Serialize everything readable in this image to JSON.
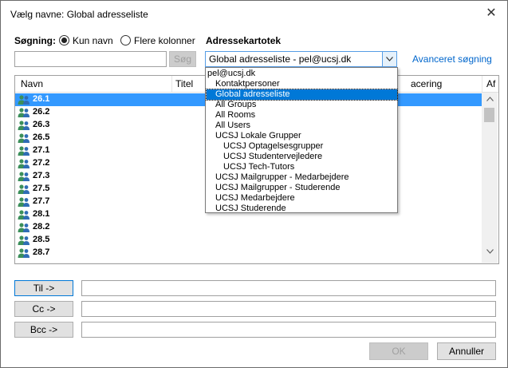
{
  "window": {
    "title": "Vælg navne: Global adresseliste",
    "close_glyph": "✕"
  },
  "search": {
    "label": "Søgning:",
    "option_name_only": "Kun navn",
    "option_more_columns": "Flere kolonner",
    "selected_option": "Kun navn",
    "input_value": "",
    "search_button": "Søg"
  },
  "address_book": {
    "label": "Adressekartotek",
    "selected": "Global adresseliste - pel@ucsj.dk",
    "advanced_link": "Avanceret søgning"
  },
  "dropdown": {
    "items": [
      {
        "label": "pel@ucsj.dk",
        "level": 0
      },
      {
        "label": "Kontaktpersoner",
        "level": 1
      },
      {
        "label": "Global adresseliste",
        "level": 1,
        "selected": true
      },
      {
        "label": "All Groups",
        "level": 1
      },
      {
        "label": "All Rooms",
        "level": 1
      },
      {
        "label": "All Users",
        "level": 1
      },
      {
        "label": "UCSJ Lokale Grupper",
        "level": 1
      },
      {
        "label": "UCSJ Optagelsesgrupper",
        "level": 2
      },
      {
        "label": "UCSJ Studentervejledere",
        "level": 2
      },
      {
        "label": "UCSJ Tech-Tutors",
        "level": 2
      },
      {
        "label": "UCSJ Mailgrupper - Medarbejdere",
        "level": 1
      },
      {
        "label": "UCSJ Mailgrupper - Studerende",
        "level": 1
      },
      {
        "label": "UCSJ Medarbejdere",
        "level": 1
      },
      {
        "label": "UCSJ Studerende",
        "level": 1
      }
    ]
  },
  "list": {
    "columns": [
      "Navn",
      "Titel",
      "acering",
      "Af"
    ],
    "rows": [
      "26.1",
      "26.2",
      "26.3",
      "26.5",
      "27.1",
      "27.2",
      "27.3",
      "27.5",
      "27.7",
      "28.1",
      "28.2",
      "28.5",
      "28.7"
    ],
    "selected_row": "26.1"
  },
  "recipients": {
    "to_button": "Til ->",
    "cc_button": "Cc ->",
    "bcc_button": "Bcc ->",
    "to_value": "",
    "cc_value": "",
    "bcc_value": ""
  },
  "footer": {
    "ok_button": "OK",
    "cancel_button": "Annuller"
  },
  "colors": {
    "accent": "#0078d7",
    "selection": "#3399ff",
    "link": "#0066cc"
  }
}
